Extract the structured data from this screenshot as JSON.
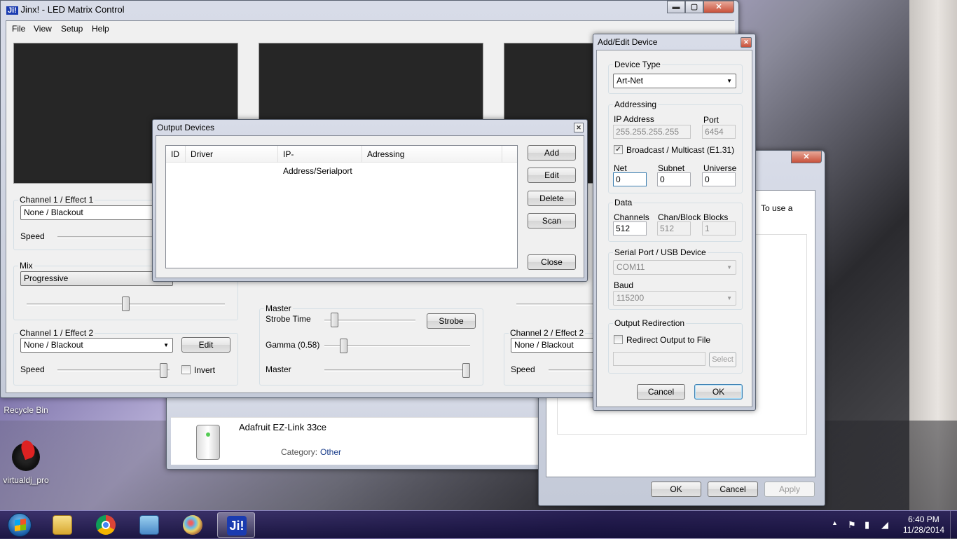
{
  "desktop": {
    "icons": [
      {
        "label": "Recycle Bin"
      },
      {
        "label": "virtualdj_pro"
      }
    ]
  },
  "main_window": {
    "title": "Jinx! - LED Matrix Control",
    "logo": "Ji!",
    "menu": [
      "File",
      "View",
      "Setup",
      "Help"
    ],
    "ch1e1": {
      "group": "Channel 1 / Effect 1",
      "effect": "None / Blackout",
      "speed_label": "Speed"
    },
    "mix": {
      "group": "Mix",
      "value": "Progressive",
      "slider_level": 0.5
    },
    "ch1e2": {
      "group": "Channel 1 / Effect 2",
      "effect": "None / Blackout",
      "edit": "Edit",
      "speed_label": "Speed",
      "invert": "Invert",
      "speed_level": 1.0
    },
    "master": {
      "group": "Master",
      "strobe_label": "Strobe Time",
      "strobe_btn": "Strobe",
      "gamma_label": "Gamma (0.58)",
      "master_label": "Master",
      "strobe_level": 0.1,
      "gamma_level": 0.13,
      "master_level": 1.0
    },
    "ch2e2": {
      "group": "Channel 2 / Effect 2",
      "effect": "None / Blackout",
      "speed_label": "Speed"
    }
  },
  "output_devices": {
    "title": "Output Devices",
    "columns": [
      "ID",
      "Driver",
      "IP-Address/Serialport",
      "Adressing"
    ],
    "rows": [],
    "buttons": {
      "add": "Add",
      "edit": "Edit",
      "delete": "Delete",
      "scan": "Scan",
      "close": "Close"
    }
  },
  "add_edit_device": {
    "title": "Add/Edit Device",
    "device_type_group": "Device Type",
    "device_type": "Art-Net",
    "addressing_group": "Addressing",
    "ip_label": "IP Address",
    "ip_value": "255.255.255.255",
    "port_label": "Port",
    "port_value": "6454",
    "broadcast_label": "Broadcast / Multicast (E1.31)",
    "broadcast_checked": true,
    "net_label": "Net",
    "net_value": "0",
    "subnet_label": "Subnet",
    "subnet_value": "0",
    "universe_label": "Universe",
    "universe_value": "0",
    "data_group": "Data",
    "channels_label": "Channels",
    "channels_value": "512",
    "chanblock_label": "Chan/Block",
    "chanblock_value": "512",
    "blocks_label": "Blocks",
    "blocks_value": "1",
    "serial_group": "Serial Port / USB Device",
    "serial_value": "COM11",
    "baud_label": "Baud",
    "baud_value": "115200",
    "redirect_group": "Output Redirection",
    "redirect_label": "Redirect Output to File",
    "redirect_checked": false,
    "select_btn": "Select",
    "cancel_btn": "Cancel",
    "ok_btn": "OK"
  },
  "device_window": {
    "device_name": "Adafruit EZ-Link 33ce",
    "category_label": "Category:",
    "category_value": "Other"
  },
  "properties_window": {
    "fragment_text": "To use a",
    "ok": "OK",
    "cancel": "Cancel",
    "apply": "Apply"
  },
  "taskbar": {
    "time": "6:40 PM",
    "date": "11/28/2014",
    "jinx_label": "Ji!"
  }
}
